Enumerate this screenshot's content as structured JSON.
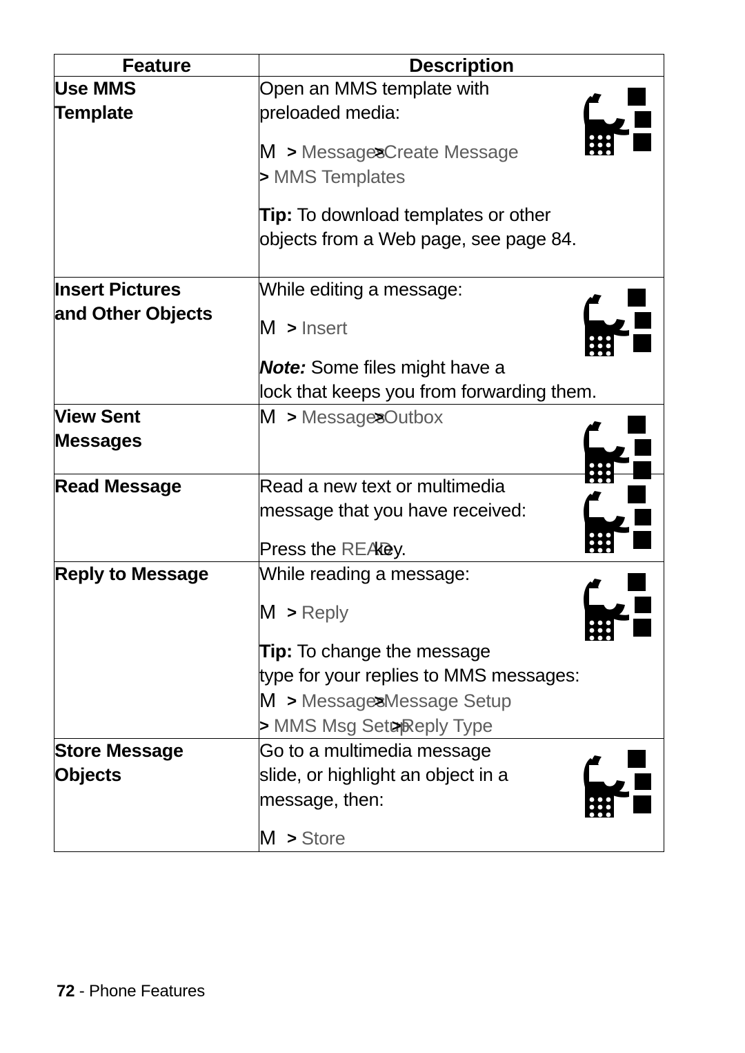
{
  "document": {
    "table": {
      "headers": {
        "feature": "Feature",
        "description": "Description"
      },
      "rows": [
        {
          "feature": "Use MMS Template",
          "feature_lines": [
            "Use MMS",
            "Template"
          ],
          "description_blocks": [
            {
              "type": "text",
              "lines": [
                "Open an MMS template with",
                "preloaded media:"
              ]
            },
            {
              "type": "path",
              "key": "M",
              "segments": [
                "Messages",
                "Create Message",
                "MMS Templates"
              ],
              "line1": "Messages",
              "line1b": "Create Message",
              "line2": "MMS Templates"
            },
            {
              "type": "tip",
              "lead": "Tip:",
              "lines": [
                "To download templates or other",
                "objects from a Web page, see page 84."
              ],
              "line1_rest": " To download templates or other",
              "line2": "objects from a Web page, see page 84."
            }
          ],
          "icon": "mms-phone-icon"
        },
        {
          "feature": "Insert Pictures and Other Objects",
          "feature_lines": [
            "Insert Pictures",
            "and Other Objects"
          ],
          "description_blocks": [
            {
              "type": "text",
              "lines": [
                "While editing a message:"
              ]
            },
            {
              "type": "path",
              "key": "M",
              "segments": [
                "Insert"
              ],
              "line1": "Insert"
            },
            {
              "type": "note",
              "lead": "Note:",
              "lines": [
                "Some files might have a",
                "lock that keeps you from forwarding them."
              ],
              "line1_rest": " Some files might have a",
              "line2": "lock that keeps you from forwarding them."
            }
          ],
          "icon": "mms-phone-icon"
        },
        {
          "feature": "View Sent Messages",
          "feature_lines": [
            "View Sent",
            "Messages"
          ],
          "description_blocks": [
            {
              "type": "path",
              "key": "M",
              "segments": [
                "Messages",
                "Outbox"
              ],
              "line1": "Messages",
              "line1b": "Outbox"
            }
          ],
          "icon": "mms-phone-icon"
        },
        {
          "feature": "Read Message",
          "feature_lines": [
            "Read Message"
          ],
          "description_blocks": [
            {
              "type": "text",
              "lines": [
                "Read a new text or multimedia",
                "message that you have received:"
              ]
            },
            {
              "type": "keypress",
              "before": "Press the ",
              "key": "READ",
              "after": "key."
            }
          ],
          "icon": "mms-phone-icon"
        },
        {
          "feature": "Reply to Message",
          "feature_lines": [
            "Reply to Message"
          ],
          "description_blocks": [
            {
              "type": "text",
              "lines": [
                "While reading a message:"
              ]
            },
            {
              "type": "path",
              "key": "M",
              "segments": [
                "Reply"
              ],
              "line1": "Reply"
            },
            {
              "type": "tip",
              "lead": "Tip:",
              "lines": [
                "To change the message",
                "type for your replies to MMS messages:"
              ],
              "line1_rest": " To change the message",
              "line2": "type for your replies to MMS messages:"
            },
            {
              "type": "path",
              "key": "M",
              "segments": [
                "Messages",
                "Message Setup",
                "MMS Msg Setup",
                "Reply Type"
              ],
              "line1": "Messages",
              "line1b": "Message Setup",
              "line2": "MMS Msg Setup",
              "line2b": "Reply Type"
            }
          ],
          "icon": "mms-phone-icon"
        },
        {
          "feature": "Store Message Objects",
          "feature_lines": [
            "Store Message",
            "Objects"
          ],
          "description_blocks": [
            {
              "type": "text",
              "lines": [
                "Go to a multimedia message",
                "slide, or highlight an object in a",
                "message, then:"
              ]
            },
            {
              "type": "path",
              "key": "M",
              "segments": [
                "Store"
              ],
              "line1": "Store"
            }
          ],
          "icon": "mms-phone-icon"
        }
      ]
    },
    "footer": {
      "page_number": "72",
      "separator": "-",
      "section": "Phone Features"
    },
    "colors": {
      "text": "#000000",
      "menu_path": "#5c5c5c",
      "border": "#000000",
      "background": "#ffffff"
    },
    "icons": {
      "phone": "mms-phone-icon",
      "chevron": ">"
    }
  }
}
